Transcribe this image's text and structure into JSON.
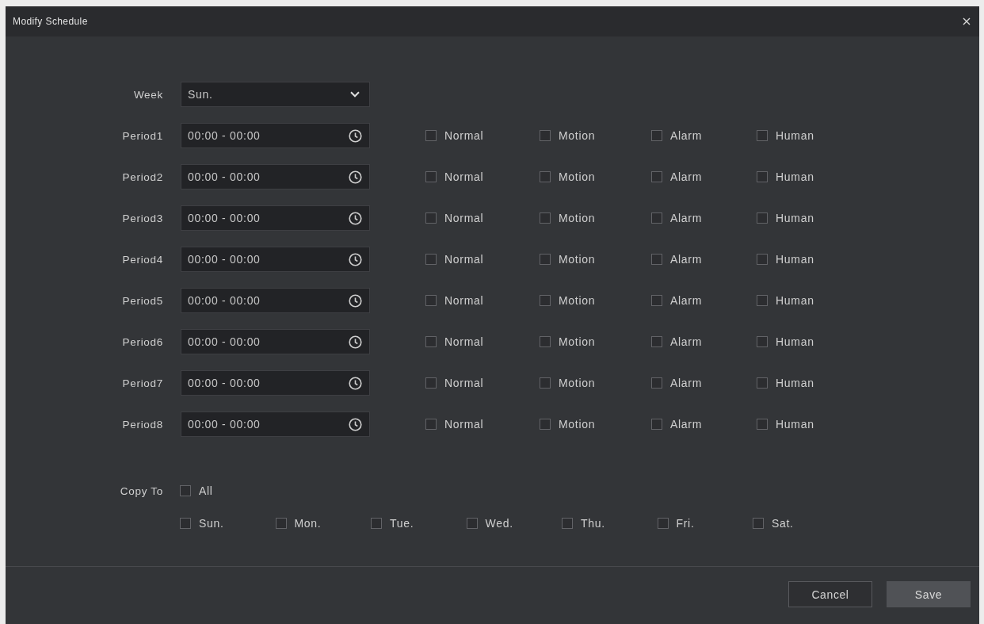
{
  "dialog": {
    "title": "Modify Schedule"
  },
  "week": {
    "label": "Week",
    "value": "Sun."
  },
  "periods": [
    {
      "label": "Period1",
      "time": "00:00 - 00:00",
      "options": [
        {
          "label": "Normal",
          "checked": false
        },
        {
          "label": "Motion",
          "checked": false
        },
        {
          "label": "Alarm",
          "checked": false
        },
        {
          "label": "Human",
          "checked": false
        }
      ]
    },
    {
      "label": "Period2",
      "time": "00:00 - 00:00",
      "options": [
        {
          "label": "Normal",
          "checked": false
        },
        {
          "label": "Motion",
          "checked": false
        },
        {
          "label": "Alarm",
          "checked": false
        },
        {
          "label": "Human",
          "checked": false
        }
      ]
    },
    {
      "label": "Period3",
      "time": "00:00 - 00:00",
      "options": [
        {
          "label": "Normal",
          "checked": false
        },
        {
          "label": "Motion",
          "checked": false
        },
        {
          "label": "Alarm",
          "checked": false
        },
        {
          "label": "Human",
          "checked": false
        }
      ]
    },
    {
      "label": "Period4",
      "time": "00:00 - 00:00",
      "options": [
        {
          "label": "Normal",
          "checked": false
        },
        {
          "label": "Motion",
          "checked": false
        },
        {
          "label": "Alarm",
          "checked": false
        },
        {
          "label": "Human",
          "checked": false
        }
      ]
    },
    {
      "label": "Period5",
      "time": "00:00 - 00:00",
      "options": [
        {
          "label": "Normal",
          "checked": false
        },
        {
          "label": "Motion",
          "checked": false
        },
        {
          "label": "Alarm",
          "checked": false
        },
        {
          "label": "Human",
          "checked": false
        }
      ]
    },
    {
      "label": "Period6",
      "time": "00:00 - 00:00",
      "options": [
        {
          "label": "Normal",
          "checked": false
        },
        {
          "label": "Motion",
          "checked": false
        },
        {
          "label": "Alarm",
          "checked": false
        },
        {
          "label": "Human",
          "checked": false
        }
      ]
    },
    {
      "label": "Period7",
      "time": "00:00 - 00:00",
      "options": [
        {
          "label": "Normal",
          "checked": false
        },
        {
          "label": "Motion",
          "checked": false
        },
        {
          "label": "Alarm",
          "checked": false
        },
        {
          "label": "Human",
          "checked": false
        }
      ]
    },
    {
      "label": "Period8",
      "time": "00:00 - 00:00",
      "options": [
        {
          "label": "Normal",
          "checked": false
        },
        {
          "label": "Motion",
          "checked": false
        },
        {
          "label": "Alarm",
          "checked": false
        },
        {
          "label": "Human",
          "checked": false
        }
      ]
    }
  ],
  "copy_to": {
    "label": "Copy To",
    "all": {
      "label": "All",
      "checked": false
    },
    "days": [
      {
        "label": "Sun.",
        "checked": false
      },
      {
        "label": "Mon.",
        "checked": false
      },
      {
        "label": "Tue.",
        "checked": false
      },
      {
        "label": "Wed.",
        "checked": false
      },
      {
        "label": "Thu.",
        "checked": false
      },
      {
        "label": "Fri.",
        "checked": false
      },
      {
        "label": "Sat.",
        "checked": false
      }
    ]
  },
  "buttons": [
    {
      "label": "Cancel",
      "kind": "secondary"
    },
    {
      "label": "Save",
      "kind": "primary"
    }
  ]
}
